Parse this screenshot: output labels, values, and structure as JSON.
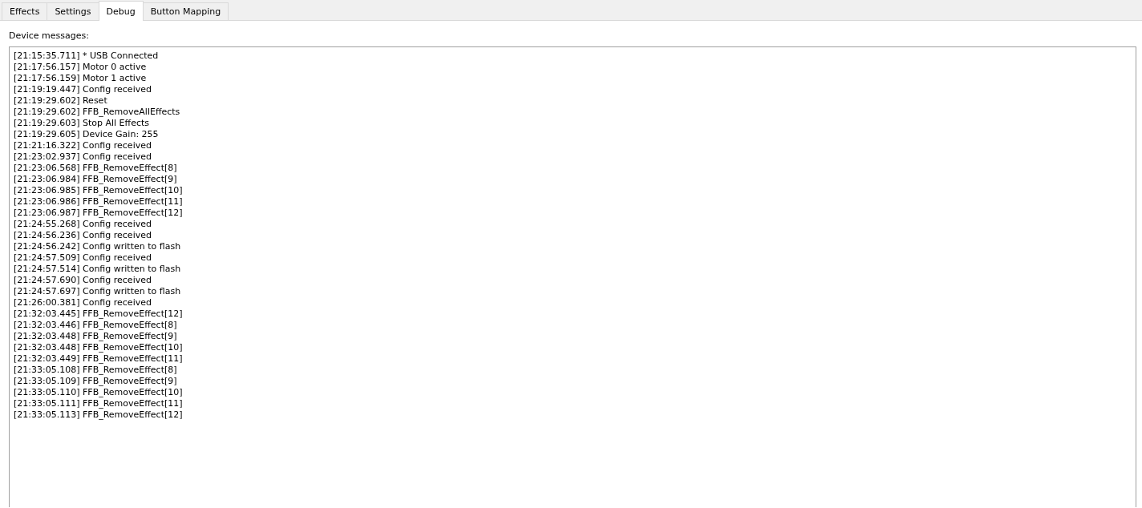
{
  "tabs": [
    {
      "label": "Effects",
      "selected": false
    },
    {
      "label": "Settings",
      "selected": false
    },
    {
      "label": "Debug",
      "selected": true
    },
    {
      "label": "Button Mapping",
      "selected": false
    }
  ],
  "panel": {
    "label": "Device messages:",
    "log": [
      "[21:15:35.711] * USB Connected",
      "[21:17:56.157] Motor 0 active",
      "[21:17:56.159] Motor 1 active",
      "[21:19:19.447] Config received",
      "[21:19:29.602] Reset",
      "[21:19:29.602] FFB_RemoveAllEffects",
      "[21:19:29.603] Stop All Effects",
      "[21:19:29.605] Device Gain: 255",
      "[21:21:16.322] Config received",
      "[21:23:02.937] Config received",
      "[21:23:06.568] FFB_RemoveEffect[8]",
      "[21:23:06.984] FFB_RemoveEffect[9]",
      "[21:23:06.985] FFB_RemoveEffect[10]",
      "[21:23:06.986] FFB_RemoveEffect[11]",
      "[21:23:06.987] FFB_RemoveEffect[12]",
      "[21:24:55.268] Config received",
      "[21:24:56.236] Config received",
      "[21:24:56.242] Config written to flash",
      "[21:24:57.509] Config received",
      "[21:24:57.514] Config written to flash",
      "[21:24:57.690] Config received",
      "[21:24:57.697] Config written to flash",
      "[21:26:00.381] Config received",
      "[21:32:03.445] FFB_RemoveEffect[12]",
      "[21:32:03.446] FFB_RemoveEffect[8]",
      "[21:32:03.448] FFB_RemoveEffect[9]",
      "[21:32:03.448] FFB_RemoveEffect[10]",
      "[21:32:03.449] FFB_RemoveEffect[11]",
      "[21:33:05.108] FFB_RemoveEffect[8]",
      "[21:33:05.109] FFB_RemoveEffect[9]",
      "[21:33:05.110] FFB_RemoveEffect[10]",
      "[21:33:05.111] FFB_RemoveEffect[11]",
      "[21:33:05.113] FFB_RemoveEffect[12]"
    ]
  }
}
